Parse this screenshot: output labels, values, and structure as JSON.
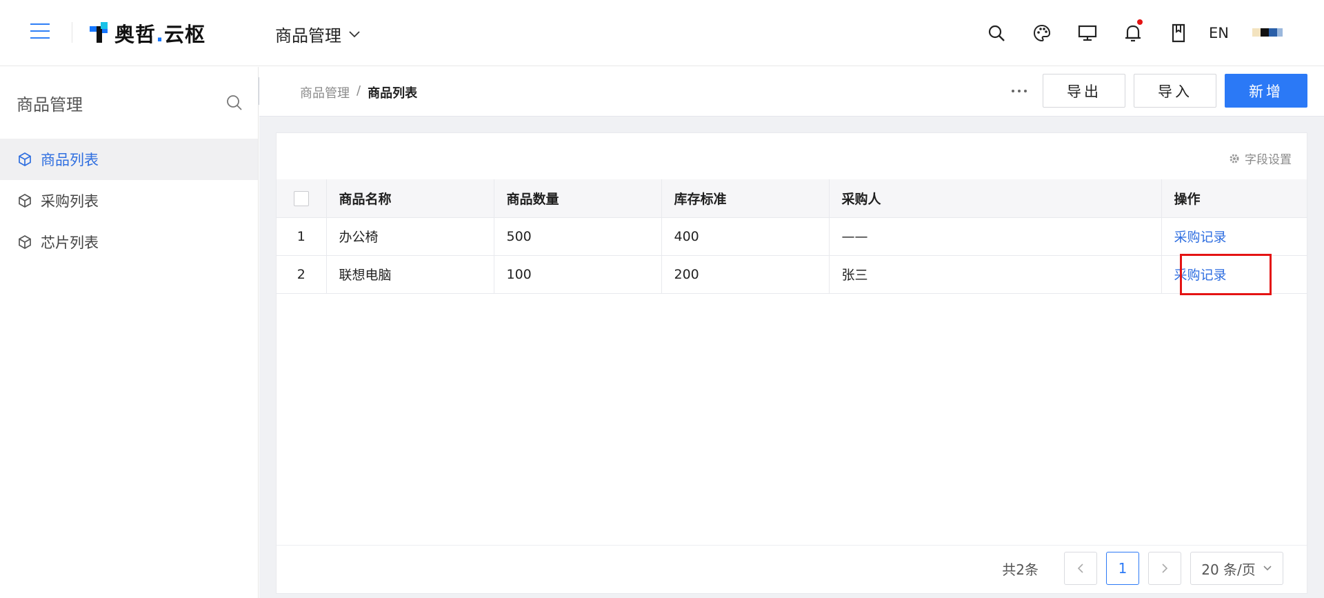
{
  "header": {
    "logo_text": "奥哲",
    "logo_dot": ".",
    "logo_suffix": "云枢",
    "module": "商品管理",
    "lang": "EN",
    "icons": [
      "menu-icon",
      "search-icon",
      "palette-icon",
      "monitor-icon",
      "bell-icon",
      "bookmark-icon"
    ],
    "notification_dot_color": "#e41313"
  },
  "sidebar": {
    "title": "商品管理",
    "items": [
      {
        "label": "商品列表",
        "active": true
      },
      {
        "label": "采购列表",
        "active": false
      },
      {
        "label": "芯片列表",
        "active": false
      }
    ]
  },
  "breadcrumb": {
    "parent": "商品管理",
    "separator": "/",
    "current": "商品列表"
  },
  "toolbar": {
    "export_label": "导出",
    "import_label": "导入",
    "add_label": "新增"
  },
  "card": {
    "field_settings": "字段设置"
  },
  "table": {
    "columns": [
      "商品名称",
      "商品数量",
      "库存标准",
      "采购人",
      "操作"
    ],
    "rows": [
      {
        "index": "1",
        "name": "办公椅",
        "quantity": "500",
        "stock": "400",
        "buyer": "——",
        "action": "采购记录"
      },
      {
        "index": "2",
        "name": "联想电脑",
        "quantity": "100",
        "stock": "200",
        "buyer": "张三",
        "action": "采购记录"
      }
    ]
  },
  "pagination": {
    "total": "共2条",
    "current_page": "1",
    "page_size": "20 条/页"
  },
  "colors": {
    "primary": "#2b79f6",
    "link": "#2e6ee0",
    "highlight": "#e41313"
  }
}
